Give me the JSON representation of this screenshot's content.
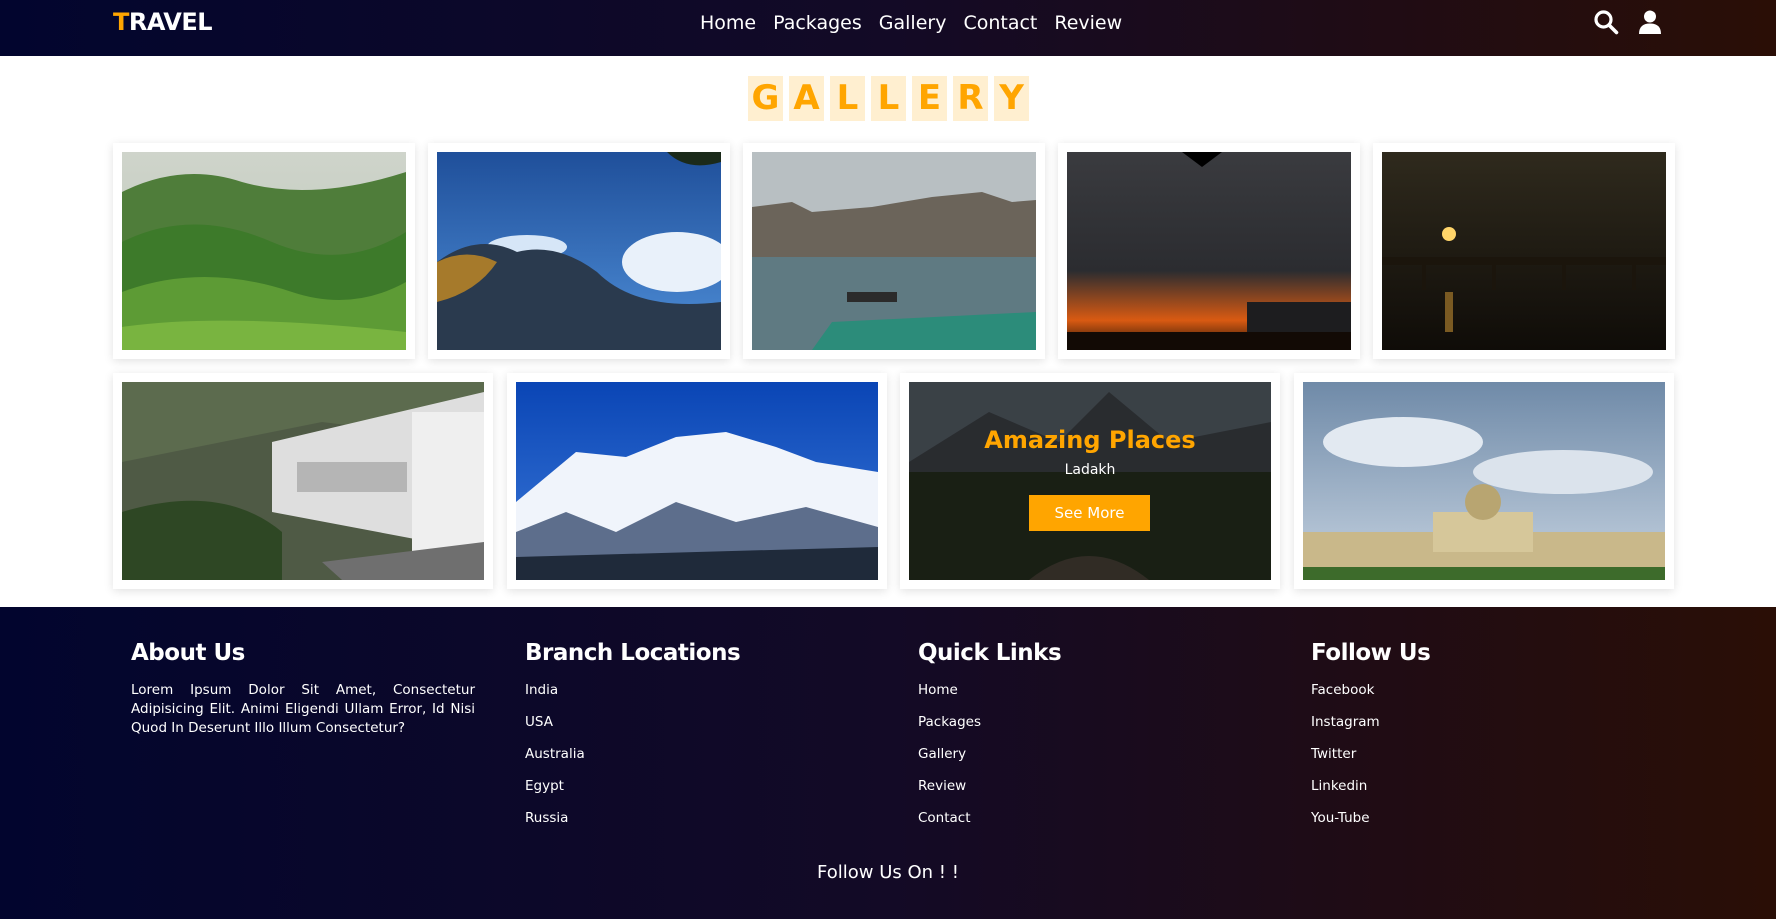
{
  "nav": {
    "logo_first": "T",
    "logo_rest": "RAVEL",
    "links": [
      "Home",
      "Packages",
      "Gallery",
      "Contact",
      "Review"
    ],
    "icons": [
      "search-icon",
      "user-icon"
    ]
  },
  "gallery": {
    "heading_letters": [
      "G",
      "A",
      "L",
      "L",
      "E",
      "R",
      "Y"
    ],
    "photos": [
      "green-hills-image",
      "blue-sky-mountain-image",
      "river-boat-image",
      "sunset-clouds-image",
      "bridge-sunset-image",
      "hillside-buildings-image",
      "snow-mountains-image",
      "forest-valley-image",
      "palace-building-image"
    ],
    "hover_card": {
      "title": "Amazing Places",
      "subtitle": "Ladakh",
      "button": "See More"
    }
  },
  "footer": {
    "about": {
      "heading": "About Us",
      "text": "Lorem Ipsum Dolor Sit Amet, Consectetur Adipisicing Elit. Animi Eligendi Ullam Error, Id Nisi Quod In Deserunt Illo Illum Consectetur?"
    },
    "branches": {
      "heading": "Branch Locations",
      "items": [
        "India",
        "USA",
        "Australia",
        "Egypt",
        "Russia"
      ]
    },
    "quick_links": {
      "heading": "Quick Links",
      "items": [
        "Home",
        "Packages",
        "Gallery",
        "Review",
        "Contact"
      ]
    },
    "follow": {
      "heading": "Follow Us",
      "items": [
        "Facebook",
        "Instagram",
        "Twitter",
        "Linkedin",
        "You-Tube"
      ]
    },
    "follow_on": "Follow Us On ! !"
  },
  "colors": {
    "accent": "#ffa500",
    "nav_gradient_start": "#02052e",
    "nav_gradient_end": "#2a0e06"
  }
}
